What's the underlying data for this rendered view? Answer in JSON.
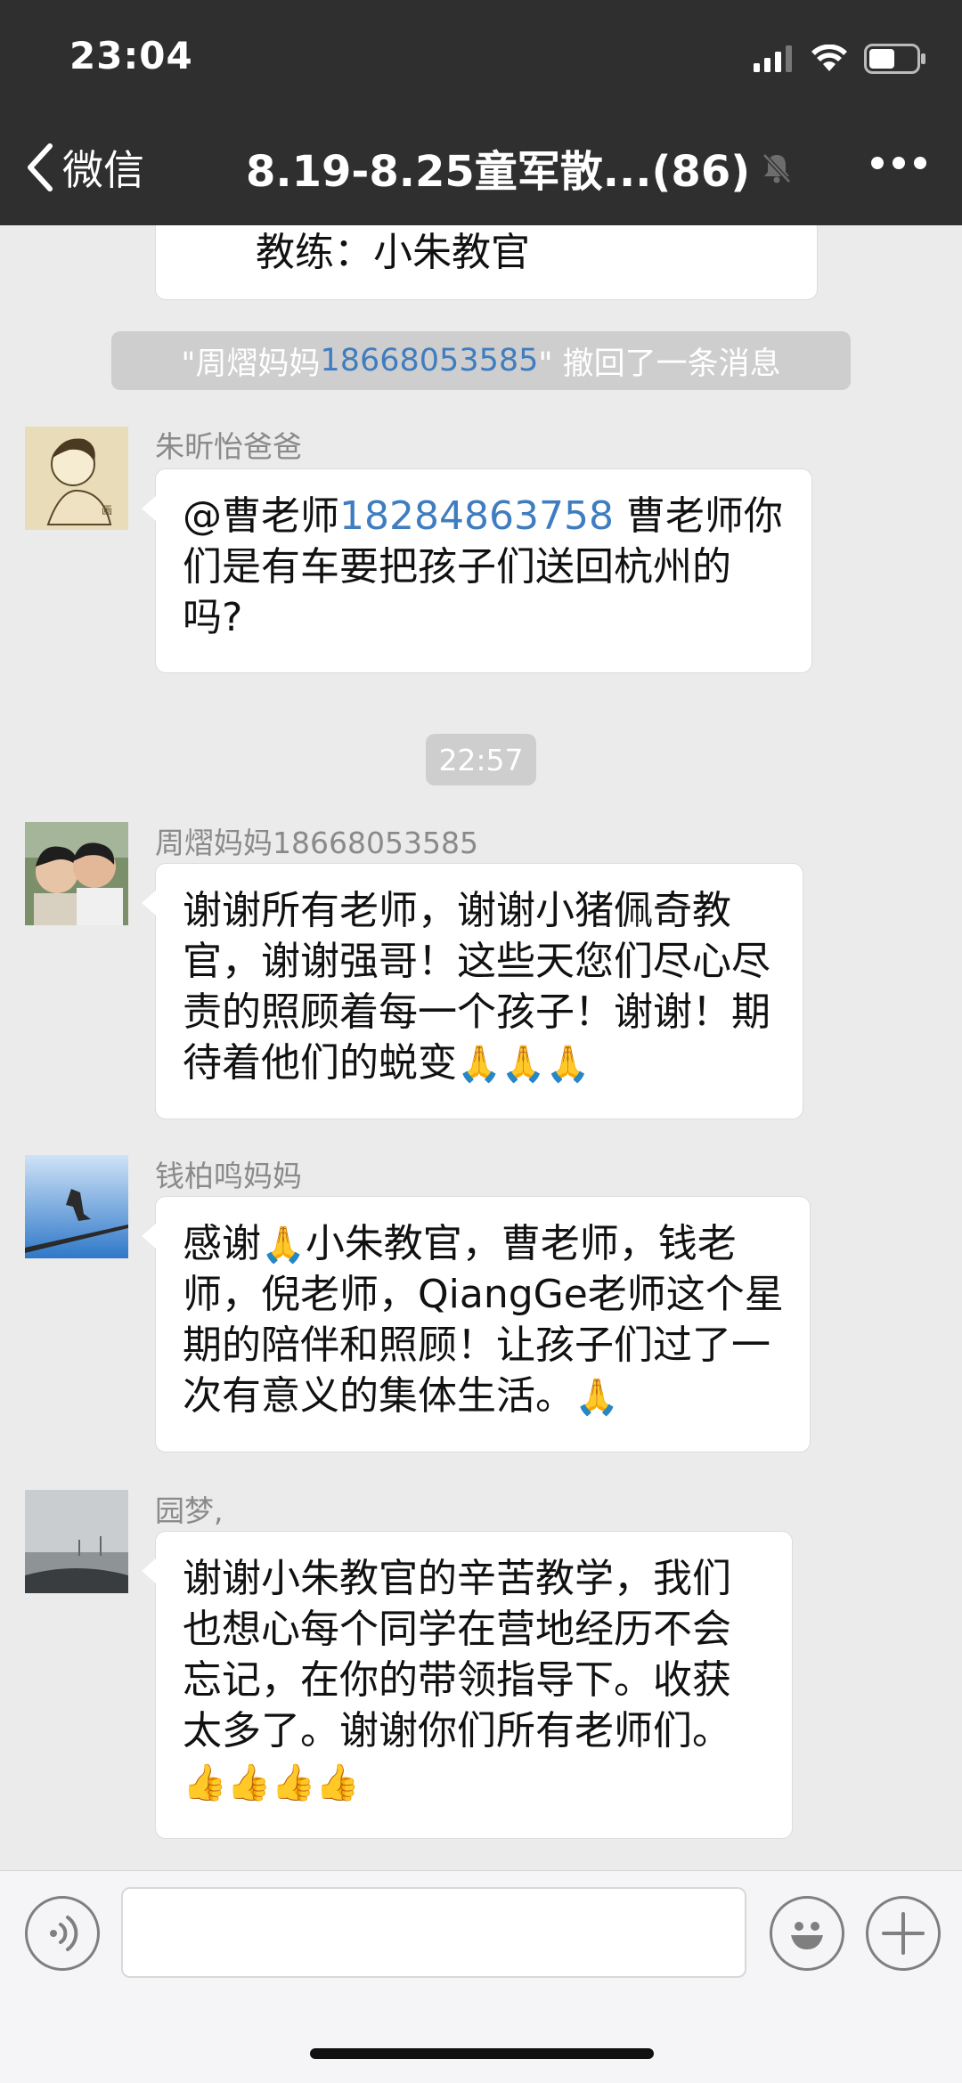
{
  "status_bar": {
    "time": "23:04"
  },
  "nav": {
    "back_label": "微信",
    "title": "8.19-8.25童军散...(86)"
  },
  "messages": {
    "top_partial_text": "教练：小朱教官",
    "recall_notice": {
      "prefix": "\"周熠妈妈",
      "phone": "18668053585",
      "suffix": "\" 撤回了一条消息"
    },
    "m1": {
      "sender": "朱昕怡爸爸",
      "mention": "@曹老师",
      "phone": "18284863758",
      "text": " 曹老师你们是有车要把孩子们送回杭州的吗?"
    },
    "timestamp": "22:57",
    "m2": {
      "sender": "周熠妈妈18668053585",
      "text": "谢谢所有老师，谢谢小猪佩奇教官，谢谢强哥！这些天您们尽心尽责的照顾着每一个孩子！谢谢！期待着他们的蜕变",
      "emoji": "🙏🙏🙏"
    },
    "m3": {
      "sender": "钱柏鸣妈妈",
      "text_before": "感谢",
      "emoji_inline": "🙏",
      "text": "小朱教官，曹老师，钱老师，倪老师，QiangGe老师这个星期的陪伴和照顾！让孩子们过了一次有意义的集体生活。",
      "emoji_end": "🙏"
    },
    "m4": {
      "sender": "园梦,",
      "text": "谢谢小朱教官的辛苦教学，我们也想心每个同学在营地经历不会忘记，在你的带领指导下。收获太多了。谢谢你们所有老师们。",
      "emoji": "👍👍👍👍"
    }
  },
  "input": {
    "placeholder": ""
  }
}
